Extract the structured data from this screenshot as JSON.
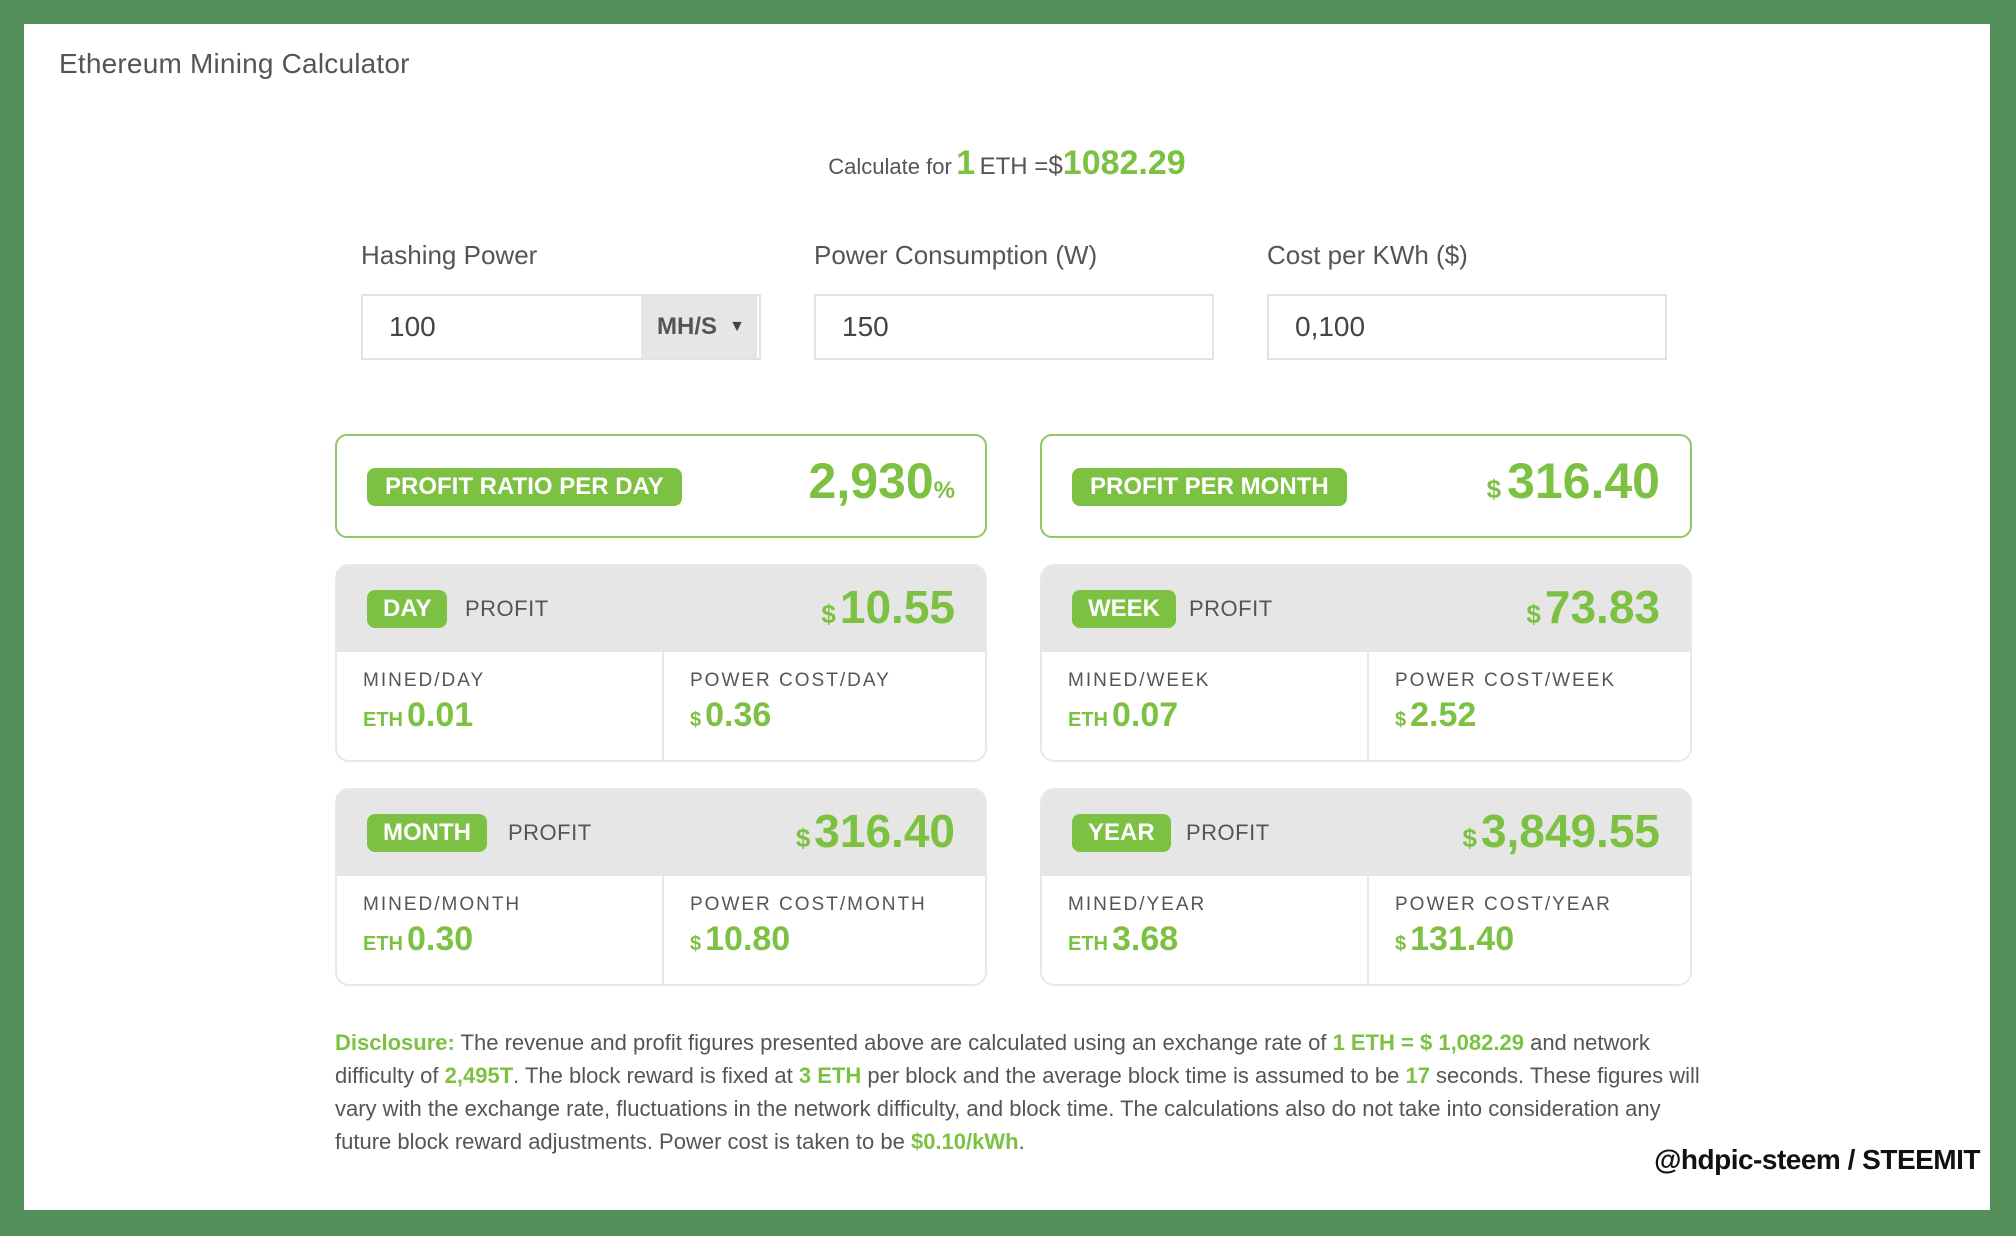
{
  "app": {
    "title": "Ethereum Mining Calculator"
  },
  "rate": {
    "prefix": "Calculate for",
    "amount": "1",
    "coin": "ETH =",
    "currency": "$",
    "price": "1082.29"
  },
  "inputs": {
    "hashing_power": {
      "label": "Hashing Power",
      "value": "100",
      "unit": "MH/S"
    },
    "power_consumption": {
      "label": "Power Consumption (W)",
      "value": "150"
    },
    "cost_per_kwh": {
      "label": "Cost per KWh ($)",
      "value": "0,100"
    }
  },
  "summary": {
    "ratio": {
      "label": "PROFIT RATIO PER DAY",
      "value": "2,930",
      "unit": "%"
    },
    "month": {
      "label": "PROFIT PER MONTH",
      "currency": "$",
      "value": "316.40"
    }
  },
  "periods": {
    "day": {
      "badge": "DAY",
      "profit_label": "PROFIT",
      "currency": "$",
      "profit": "10.55",
      "mined_label": "MINED/DAY",
      "eth_unit": "ETH",
      "mined": "0.01",
      "cost_label": "POWER COST/DAY",
      "cost": "0.36"
    },
    "week": {
      "badge": "WEEK",
      "profit_label": "PROFIT",
      "currency": "$",
      "profit": "73.83",
      "mined_label": "MINED/WEEK",
      "eth_unit": "ETH",
      "mined": "0.07",
      "cost_label": "POWER COST/WEEK",
      "cost": "2.52"
    },
    "month": {
      "badge": "MONTH",
      "profit_label": "PROFIT",
      "currency": "$",
      "profit": "316.40",
      "mined_label": "MINED/MONTH",
      "eth_unit": "ETH",
      "mined": "0.30",
      "cost_label": "POWER COST/MONTH",
      "cost": "10.80"
    },
    "year": {
      "badge": "YEAR",
      "profit_label": "PROFIT",
      "currency": "$",
      "profit": "3,849.55",
      "mined_label": "MINED/YEAR",
      "eth_unit": "ETH",
      "mined": "3.68",
      "cost_label": "POWER COST/YEAR",
      "cost": "131.40"
    }
  },
  "disclosure": {
    "label": "Disclosure:",
    "t1": " The revenue and profit figures presented above are calculated using an exchange rate of ",
    "h1": "1 ETH = $ 1,082.29",
    "t2": " and network difficulty of ",
    "h2": "2,495T",
    "t3": ". The block reward is fixed at ",
    "h3": "3 ETH",
    "t4": " per block and the average block time is assumed to be ",
    "h4": "17",
    "t5": " seconds. These figures will vary with the exchange rate, fluctuations in the network difficulty, and block time. The calculations also do not take into consideration any future block reward adjustments. Power cost is taken to be ",
    "h5": "$0.10/kWh",
    "t6": "."
  },
  "watermark": "@hdpic-steem / STEEMIT",
  "colors": {
    "accent": "#7cc142",
    "frame": "#548e58",
    "card_header": "#e6e6e6"
  }
}
